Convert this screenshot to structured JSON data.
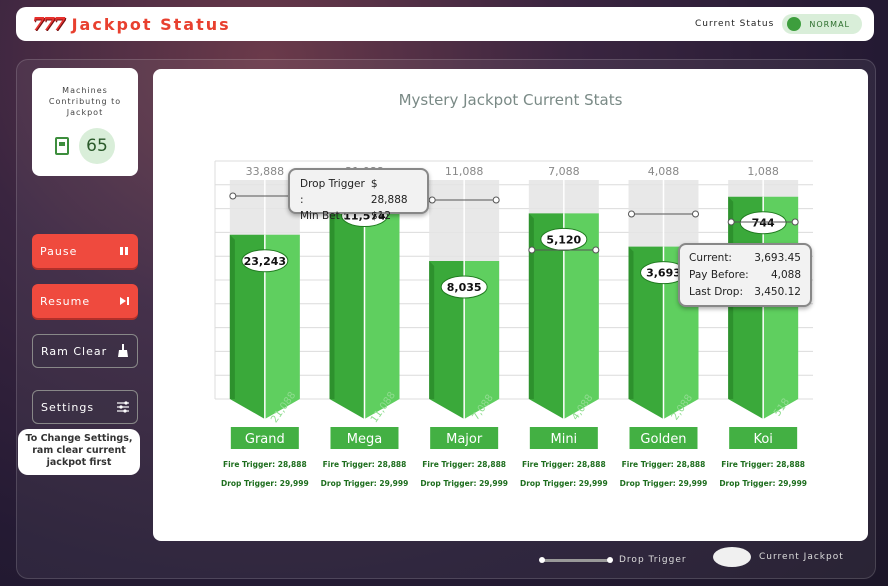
{
  "header": {
    "logo_glyph": "777",
    "title": "Jackpot Status",
    "status_label": "Current Status",
    "status_value": "NORMAL",
    "status_color": "#3d9e3d"
  },
  "machines": {
    "label": "Machines Contributng to Jackpot",
    "count": "65"
  },
  "controls": {
    "pause": "Pause",
    "resume": "Resume",
    "ram_clear": "Ram Clear",
    "settings": "Settings",
    "settings_tooltip": "To Change Settings, ram clear current jackpot first"
  },
  "chart_data": {
    "type": "bar",
    "title": "Mystery Jackpot Current Stats",
    "categories": [
      "Grand",
      "Mega",
      "Major",
      "Mini",
      "Golden",
      "Koi"
    ],
    "series": [
      {
        "name": "Current Jackpot",
        "values": [
          23243,
          11574,
          8035,
          5120,
          3693,
          744
        ]
      }
    ],
    "top_labels": [
      "33,888",
      "21,088",
      "11,088",
      "7,088",
      "4,088",
      "1,088"
    ],
    "value_labels": [
      "23,243",
      "11,574",
      "8,035",
      "5,120",
      "3,693",
      "744"
    ],
    "base_labels": [
      "21,088",
      "11,088",
      "7,088",
      "4,088",
      "2,088",
      "518"
    ],
    "capacity_fraction": [
      0.92,
      0.92,
      0.92,
      0.92,
      0.92,
      0.92
    ],
    "fill_fraction": [
      0.69,
      0.88,
      0.58,
      0.78,
      0.64,
      0.85
    ],
    "fire_triggers": [
      "Fire Trigger: 28,888",
      "Fire Trigger: 28,888",
      "Fire Trigger: 28,888",
      "Fire Trigger: 28,888",
      "Fire Trigger: 28,888",
      "Fire Trigger: 28,888"
    ],
    "drop_triggers": [
      "Drop Trigger: 29,999",
      "Drop Trigger: 29,999",
      "Drop Trigger: 29,999",
      "Drop Trigger: 29,999",
      "Drop Trigger: 29,999",
      "Drop Trigger: 29,999"
    ],
    "grid": true,
    "colors": {
      "bar": "#3aa93a",
      "bar_dark": "#1f7a1f",
      "bar_light": "#5fcf5f",
      "ghost": "#e4e4e4",
      "label_bg": "#43b043"
    }
  },
  "tooltip_drop": {
    "label1": "Drop Trigger :",
    "value1": "$ 28,888",
    "label2": "Min Bet :",
    "value2": "$12"
  },
  "tooltip_current": {
    "label1": "Current:",
    "value1": "3,693.45",
    "label2": "Pay Before:",
    "value2": "4,088",
    "label3": "Last Drop:",
    "value3": "3,450.12"
  },
  "legend": {
    "drop_trigger": "Drop Trigger",
    "current_jackpot": "Current Jackpot"
  }
}
